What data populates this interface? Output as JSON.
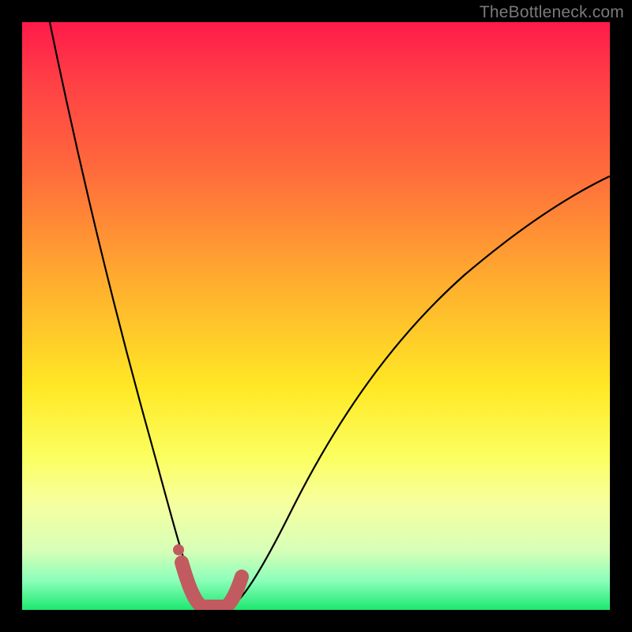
{
  "watermark": "TheBottleneck.com",
  "chart_data": {
    "type": "line",
    "title": "",
    "xlabel": "",
    "ylabel": "",
    "xlim": [
      0,
      1
    ],
    "ylim": [
      0,
      100
    ],
    "note": "Bottleneck-style V curve; y ≈ mismatch percentage, minimum ≈ 0 near x≈0.31. Values estimated from pixel positions (no numeric axes shown).",
    "series": [
      {
        "name": "mismatch-curve",
        "x": [
          0.045,
          0.1,
          0.15,
          0.2,
          0.24,
          0.27,
          0.29,
          0.31,
          0.34,
          0.38,
          0.45,
          0.55,
          0.7,
          0.85,
          1.0
        ],
        "y": [
          100,
          80,
          60,
          38,
          20,
          8,
          2,
          0,
          1,
          6,
          16,
          30,
          46,
          57,
          65
        ]
      }
    ],
    "highlight_band": {
      "x_start": 0.265,
      "x_end": 0.355,
      "color": "#c15b5f"
    },
    "highlight_dot": {
      "x": 0.265,
      "y": 4,
      "color": "#c15b5f"
    }
  }
}
